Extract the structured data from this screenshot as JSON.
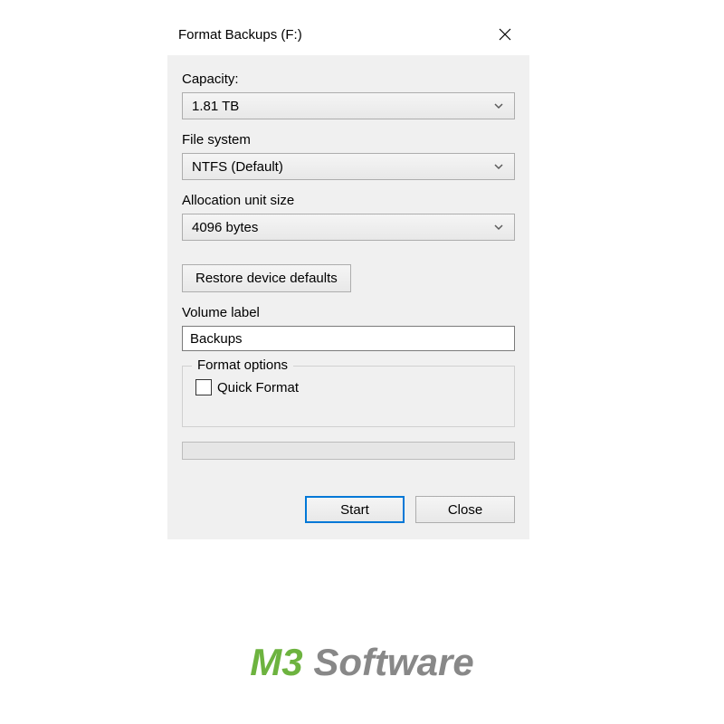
{
  "dialog": {
    "title": "Format Backups (F:)",
    "capacity": {
      "label": "Capacity:",
      "value": "1.81 TB"
    },
    "filesystem": {
      "label": "File system",
      "value": "NTFS (Default)"
    },
    "allocation": {
      "label": "Allocation unit size",
      "value": "4096 bytes"
    },
    "restore_button": "Restore device defaults",
    "volume_label": {
      "label": "Volume label",
      "value": "Backups"
    },
    "format_options": {
      "legend": "Format options",
      "quick_format": "Quick Format",
      "quick_format_checked": false
    },
    "actions": {
      "start": "Start",
      "close": "Close"
    }
  },
  "watermark": {
    "prefix": "M3",
    "suffix": " Software"
  }
}
